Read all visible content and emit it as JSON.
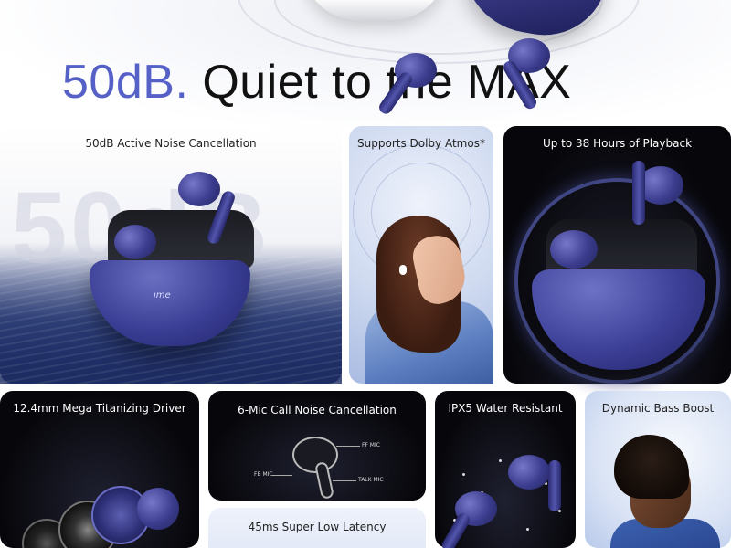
{
  "hero": {
    "title_accent": "50dB.",
    "title_rest": "Quiet to the MAX"
  },
  "tiles": {
    "anc": {
      "label": "50dB Active Noise Cancellation",
      "bg_text": "50dB",
      "logo": "ıme"
    },
    "dolby": {
      "label": "Supports Dolby Atmos*"
    },
    "playback": {
      "label": "Up to 38 Hours of Playback"
    },
    "driver": {
      "label": "12.4mm Mega Titanizing Driver"
    },
    "mic": {
      "label": "6-Mic Call Noise Cancellation",
      "mic_labels": [
        "FF MIC",
        "FB MIC",
        "TALK MIC"
      ]
    },
    "latency": {
      "label": "45ms Super Low Latency"
    },
    "ipx": {
      "label": "IPX5 Water Resistant"
    },
    "bass": {
      "label": "Dynamic Bass Boost"
    }
  },
  "colors": {
    "accent": "#5661c8",
    "earbud_blue": "#3b3c8d",
    "dark_tile": "#07070b"
  },
  "icons": [
    "earbud-icon",
    "charging-case-icon",
    "microphone-icon",
    "water-drop-icon",
    "sound-wave-icon"
  ]
}
